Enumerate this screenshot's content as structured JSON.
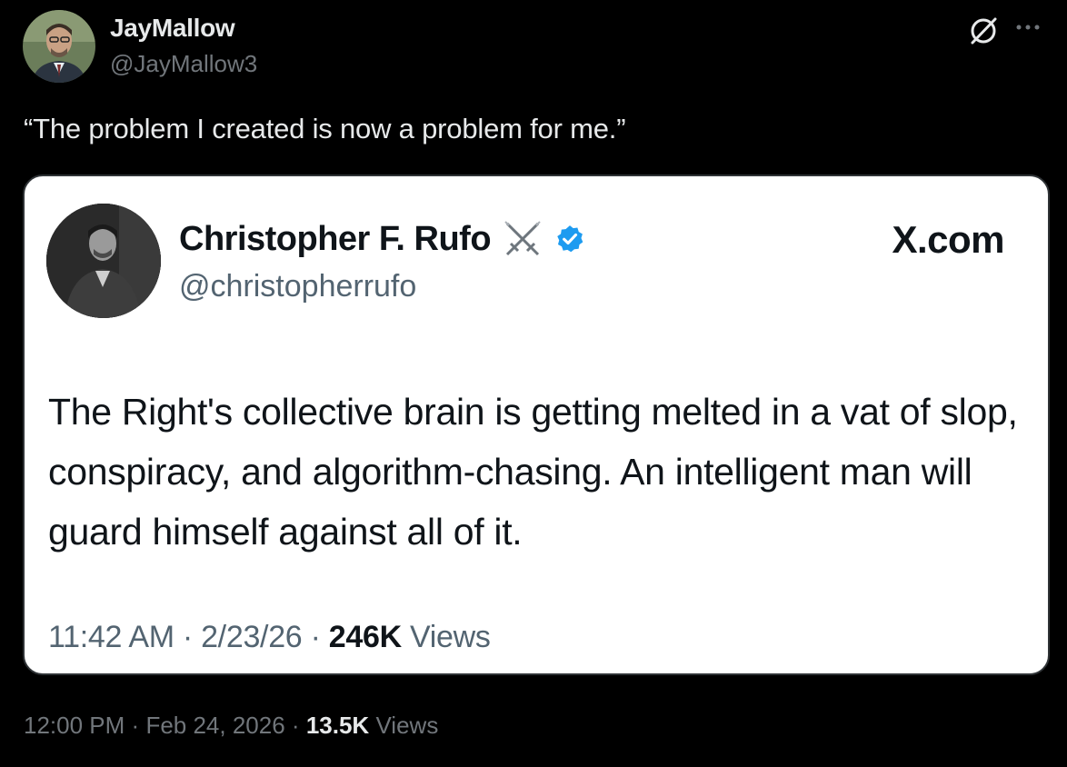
{
  "author": {
    "name": "JayMallow",
    "handle": "@JayMallow3"
  },
  "tweet": {
    "text": "“The problem I created is now a problem for me.”",
    "time": "12:00 PM",
    "date": "Feb 24, 2026",
    "views_count": "13.5K",
    "views_label": "Views"
  },
  "quoted": {
    "name": "Christopher F. Rufo",
    "handle": "@christopherrufo",
    "source": "X.com",
    "text": "The Right's collective brain is getting melted in a vat of slop, conspiracy, and algorithm-chasing. An intelligent man will guard himself against all of it.",
    "time": "11:42 AM",
    "date": "2/23/26",
    "views_count": "246K",
    "views_label": "Views"
  },
  "icons": {
    "grok": "grok-icon",
    "more": "more-icon",
    "swords": "crossed-swords-icon",
    "verified": "verified-badge-icon"
  },
  "colors": {
    "background": "#000000",
    "text_primary": "#e7e9ea",
    "text_secondary": "#71767b",
    "verified_blue": "#1d9bf0",
    "card_background": "#ffffff"
  }
}
